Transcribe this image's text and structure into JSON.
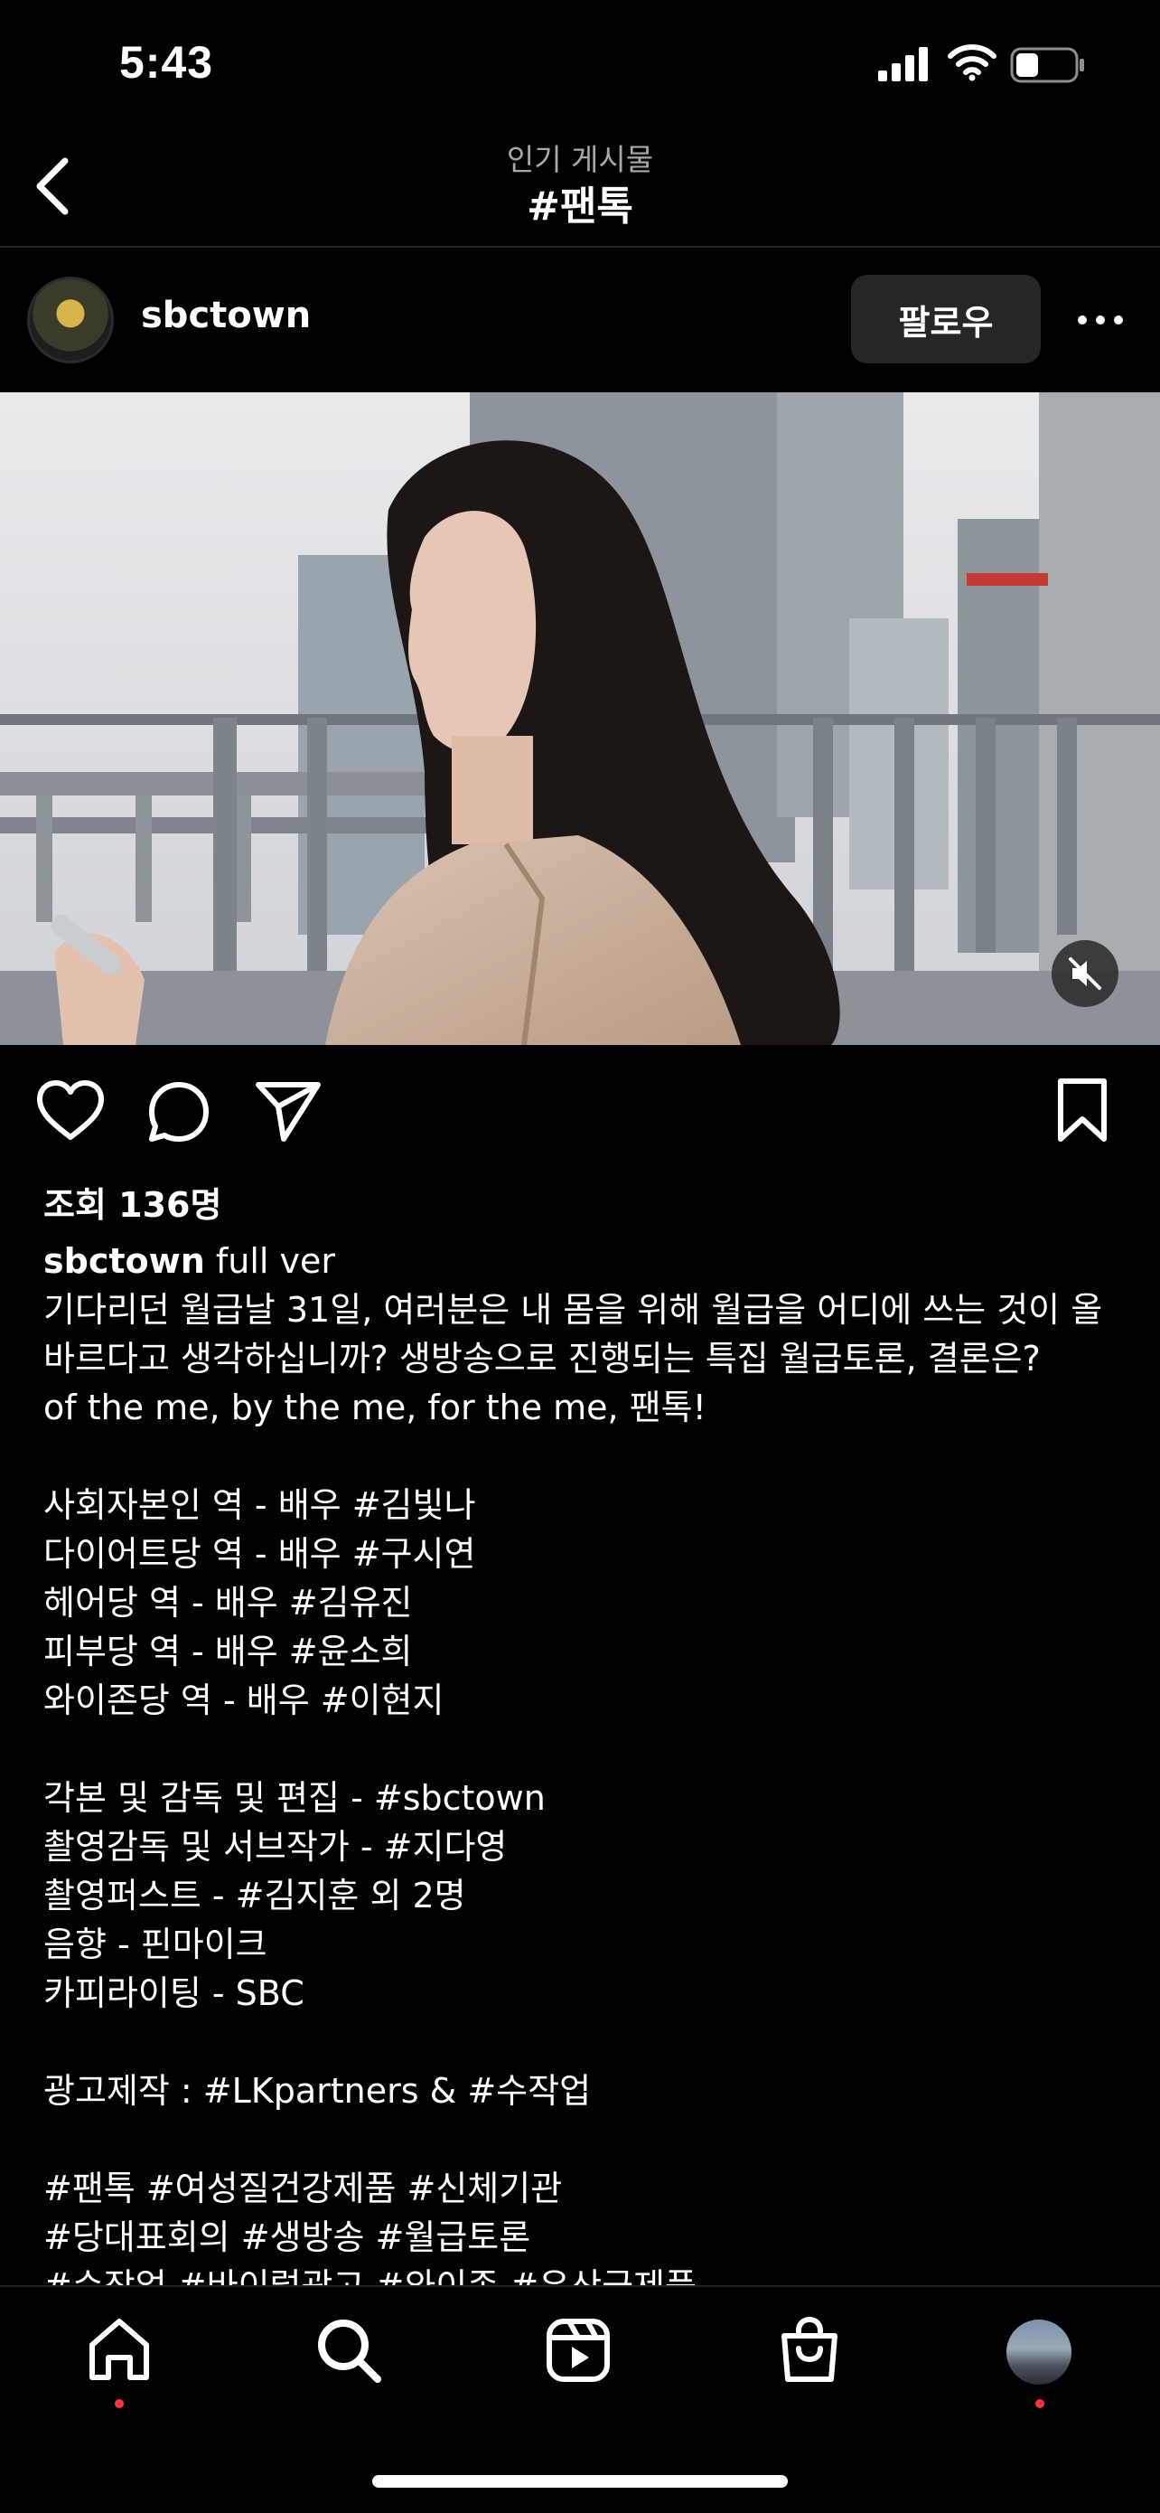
{
  "status_bar": {
    "time": "5:43"
  },
  "header": {
    "subtitle": "인기 게시물",
    "title": "#팬톡"
  },
  "post": {
    "username": "sbctown",
    "follow_label": "팔로우",
    "views": "조회 136명",
    "caption_user": "sbctown",
    "caption_text": " full ver\n기다리던 월급날 31일, 여러분은 내 몸을 위해 월급을 어디에 쓰는 것이 올바르다고 생각하십니까? 생방송으로 진행되는 특집 월급토론, 결론은?\nof the me, by the me, for the me, 팬톡!\n\n사회자본인 역 - 배우 #김빛나\n다이어트당 역 - 배우 #구시연\n헤어당 역 - 배우 #김유진\n피부당 역 - 배우 #윤소희\n와이존당 역 - 배우 #이현지\n\n각본 및 감독 및 편집 - #sbctown\n촬영감독 및 서브작가 - #지다영\n촬영퍼스트 - #김지훈 외 2명\n음향 - 핀마이크\n카피라이팅 - SBC\n\n광고제작 : #LKpartners & #수작업\n\n#팬톡 #여성질건강제품 #신체기관\n#당대표회의 #생방송 #월급토론\n#수작업 #바이럴광고 #와이존 #유산균제품"
  },
  "icons": {
    "back": "chevron-left-icon",
    "more": "more-horizontal-icon",
    "like": "heart-icon",
    "comment": "comment-bubble-icon",
    "share": "paper-plane-icon",
    "save": "bookmark-icon",
    "mute": "speaker-muted-icon"
  },
  "colors": {
    "background": "#000000",
    "secondary_text": "#a8a8a8",
    "button_bg": "#262626",
    "notification_dot": "#ff3040"
  }
}
